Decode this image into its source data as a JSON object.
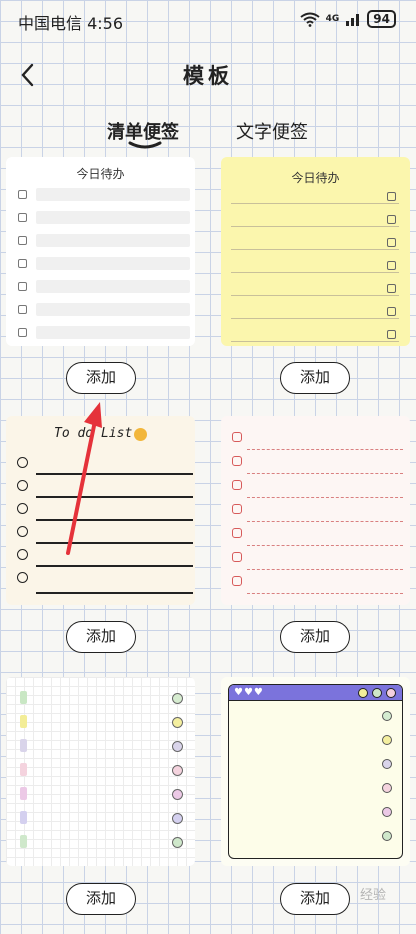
{
  "status": {
    "carrier_time": "中国电信 4:56",
    "network": "4G",
    "battery": "94"
  },
  "header": {
    "title": "模板"
  },
  "tabs": [
    {
      "label": "清单便签"
    },
    {
      "label": "文字便签"
    }
  ],
  "cards": [
    {
      "title": "今日待办",
      "add_label": "添加"
    },
    {
      "title": "今日待办",
      "add_label": "添加"
    },
    {
      "title": "To do List",
      "add_label": "添加"
    },
    {
      "title": "",
      "add_label": "添加"
    },
    {
      "title": "",
      "add_label": "添加"
    },
    {
      "title": "",
      "add_label": "添加"
    }
  ],
  "colors": {
    "accent_red": "#e5323a",
    "window_bar": "#7b73dc",
    "yellow_card": "#fbf6ad"
  },
  "watermark": "经验"
}
